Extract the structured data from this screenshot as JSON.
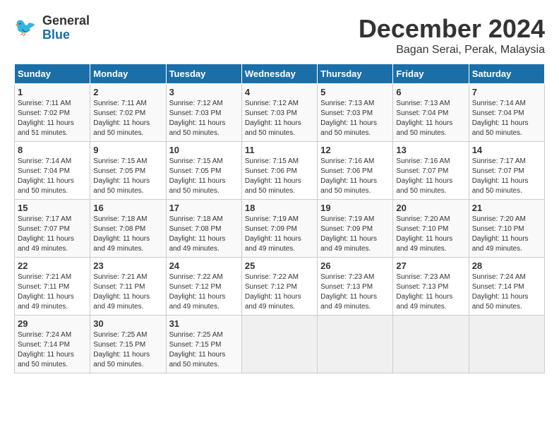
{
  "logo": {
    "text_general": "General",
    "text_blue": "Blue"
  },
  "title": "December 2024",
  "location": "Bagan Serai, Perak, Malaysia",
  "days_of_week": [
    "Sunday",
    "Monday",
    "Tuesday",
    "Wednesday",
    "Thursday",
    "Friday",
    "Saturday"
  ],
  "weeks": [
    [
      {
        "day": "1",
        "sunrise": "7:11 AM",
        "sunset": "7:02 PM",
        "daylight": "11 hours and 51 minutes."
      },
      {
        "day": "2",
        "sunrise": "7:11 AM",
        "sunset": "7:02 PM",
        "daylight": "11 hours and 50 minutes."
      },
      {
        "day": "3",
        "sunrise": "7:12 AM",
        "sunset": "7:03 PM",
        "daylight": "11 hours and 50 minutes."
      },
      {
        "day": "4",
        "sunrise": "7:12 AM",
        "sunset": "7:03 PM",
        "daylight": "11 hours and 50 minutes."
      },
      {
        "day": "5",
        "sunrise": "7:13 AM",
        "sunset": "7:03 PM",
        "daylight": "11 hours and 50 minutes."
      },
      {
        "day": "6",
        "sunrise": "7:13 AM",
        "sunset": "7:04 PM",
        "daylight": "11 hours and 50 minutes."
      },
      {
        "day": "7",
        "sunrise": "7:14 AM",
        "sunset": "7:04 PM",
        "daylight": "11 hours and 50 minutes."
      }
    ],
    [
      {
        "day": "8",
        "sunrise": "7:14 AM",
        "sunset": "7:04 PM",
        "daylight": "11 hours and 50 minutes."
      },
      {
        "day": "9",
        "sunrise": "7:15 AM",
        "sunset": "7:05 PM",
        "daylight": "11 hours and 50 minutes."
      },
      {
        "day": "10",
        "sunrise": "7:15 AM",
        "sunset": "7:05 PM",
        "daylight": "11 hours and 50 minutes."
      },
      {
        "day": "11",
        "sunrise": "7:15 AM",
        "sunset": "7:06 PM",
        "daylight": "11 hours and 50 minutes."
      },
      {
        "day": "12",
        "sunrise": "7:16 AM",
        "sunset": "7:06 PM",
        "daylight": "11 hours and 50 minutes."
      },
      {
        "day": "13",
        "sunrise": "7:16 AM",
        "sunset": "7:07 PM",
        "daylight": "11 hours and 50 minutes."
      },
      {
        "day": "14",
        "sunrise": "7:17 AM",
        "sunset": "7:07 PM",
        "daylight": "11 hours and 50 minutes."
      }
    ],
    [
      {
        "day": "15",
        "sunrise": "7:17 AM",
        "sunset": "7:07 PM",
        "daylight": "11 hours and 49 minutes."
      },
      {
        "day": "16",
        "sunrise": "7:18 AM",
        "sunset": "7:08 PM",
        "daylight": "11 hours and 49 minutes."
      },
      {
        "day": "17",
        "sunrise": "7:18 AM",
        "sunset": "7:08 PM",
        "daylight": "11 hours and 49 minutes."
      },
      {
        "day": "18",
        "sunrise": "7:19 AM",
        "sunset": "7:09 PM",
        "daylight": "11 hours and 49 minutes."
      },
      {
        "day": "19",
        "sunrise": "7:19 AM",
        "sunset": "7:09 PM",
        "daylight": "11 hours and 49 minutes."
      },
      {
        "day": "20",
        "sunrise": "7:20 AM",
        "sunset": "7:10 PM",
        "daylight": "11 hours and 49 minutes."
      },
      {
        "day": "21",
        "sunrise": "7:20 AM",
        "sunset": "7:10 PM",
        "daylight": "11 hours and 49 minutes."
      }
    ],
    [
      {
        "day": "22",
        "sunrise": "7:21 AM",
        "sunset": "7:11 PM",
        "daylight": "11 hours and 49 minutes."
      },
      {
        "day": "23",
        "sunrise": "7:21 AM",
        "sunset": "7:11 PM",
        "daylight": "11 hours and 49 minutes."
      },
      {
        "day": "24",
        "sunrise": "7:22 AM",
        "sunset": "7:12 PM",
        "daylight": "11 hours and 49 minutes."
      },
      {
        "day": "25",
        "sunrise": "7:22 AM",
        "sunset": "7:12 PM",
        "daylight": "11 hours and 49 minutes."
      },
      {
        "day": "26",
        "sunrise": "7:23 AM",
        "sunset": "7:13 PM",
        "daylight": "11 hours and 49 minutes."
      },
      {
        "day": "27",
        "sunrise": "7:23 AM",
        "sunset": "7:13 PM",
        "daylight": "11 hours and 49 minutes."
      },
      {
        "day": "28",
        "sunrise": "7:24 AM",
        "sunset": "7:14 PM",
        "daylight": "11 hours and 50 minutes."
      }
    ],
    [
      {
        "day": "29",
        "sunrise": "7:24 AM",
        "sunset": "7:14 PM",
        "daylight": "11 hours and 50 minutes."
      },
      {
        "day": "30",
        "sunrise": "7:25 AM",
        "sunset": "7:15 PM",
        "daylight": "11 hours and 50 minutes."
      },
      {
        "day": "31",
        "sunrise": "7:25 AM",
        "sunset": "7:15 PM",
        "daylight": "11 hours and 50 minutes."
      },
      null,
      null,
      null,
      null
    ]
  ],
  "labels": {
    "sunrise": "Sunrise:",
    "sunset": "Sunset:",
    "daylight": "Daylight:"
  }
}
